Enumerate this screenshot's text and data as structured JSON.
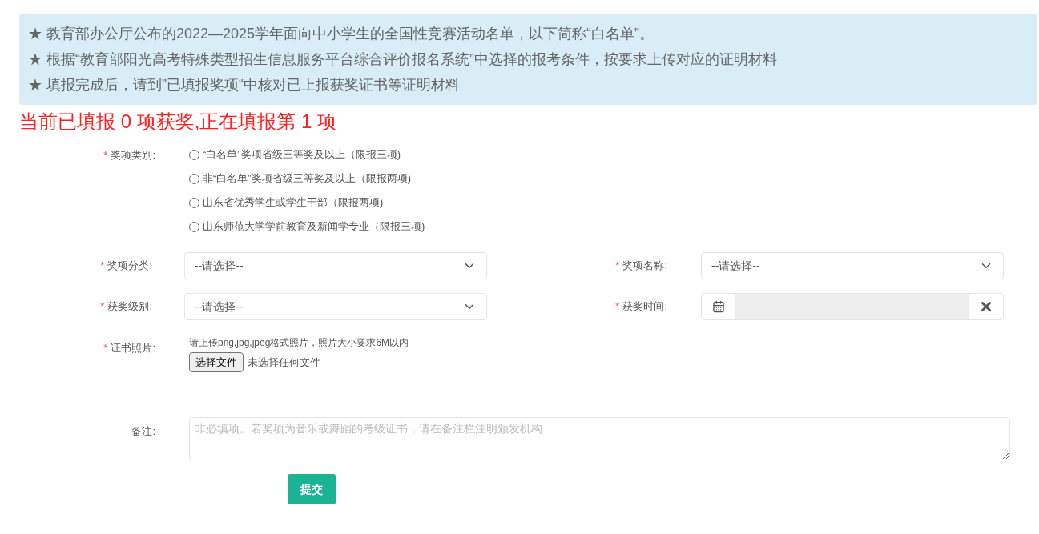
{
  "notice": {
    "lines": [
      "★ 教育部办公厅公布的2022—2025学年面向中小学生的全国性竞赛活动名单，以下简称“白名单”。",
      "★ 根据“教育部阳光高考特殊类型招生信息服务平台综合评价报名系统”中选择的报考条件，按要求上传对应的证明材料",
      "★ 填报完成后，请到”已填报奖项“中核对已上报获奖证书等证明材料"
    ]
  },
  "status": "当前已填报 0 项获奖,正在填报第 1 项",
  "award_type": {
    "label": "奖项类别:",
    "required_mark": "*",
    "options": [
      {
        "label": "“白名单”奖项省级三等奖及以上（限报三项)",
        "selected": false
      },
      {
        "label": "非“白名单”奖项省级三等奖及以上（限报两项)",
        "selected": false
      },
      {
        "label": "山东省优秀学生或学生干部（限报两项)",
        "selected": false
      },
      {
        "label": "山东师范大学学前教育及新闻学专业（限报三项)",
        "selected": false
      }
    ]
  },
  "fields": [
    {
      "label": "奖项分类:",
      "required_mark": "*",
      "kind": "select",
      "value": "--请选择--"
    },
    {
      "label": "奖项名称:",
      "required_mark": "*",
      "kind": "select",
      "value": "--请选择--"
    },
    {
      "label": "获奖级别:",
      "required_mark": "*",
      "kind": "select",
      "value": "--请选择--"
    },
    {
      "label": "获奖时间:",
      "required_mark": "*",
      "kind": "date"
    }
  ],
  "certificate": {
    "label": "证书照片:",
    "required_mark": "*",
    "hint": "请上传png,jpg,jpeg格式照片，照片大小要求6M以内",
    "button": "选择文件",
    "file_status": "未选择任何文件"
  },
  "remarks": {
    "label": "备注:",
    "placeholder": "非必填项。若奖项为音乐或舞蹈的考级证书，请在备注栏注明颁发机构"
  },
  "submit": "提交"
}
